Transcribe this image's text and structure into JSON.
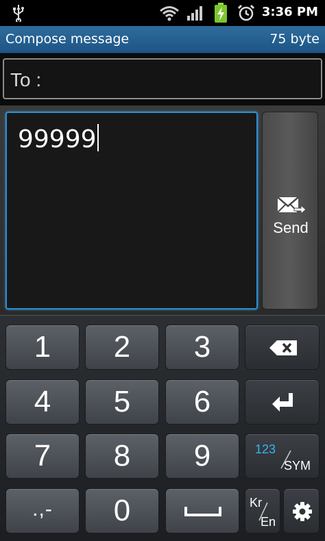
{
  "status_bar": {
    "time": "3:36 PM",
    "icons": [
      "usb-icon",
      "wifi-icon",
      "signal-icon",
      "battery-charging-icon",
      "alarm-icon"
    ]
  },
  "title_bar": {
    "title": "Compose message",
    "byte_count": "75 byte"
  },
  "recipient": {
    "label": "To :",
    "value": ""
  },
  "message": {
    "text": "99999"
  },
  "send_button": {
    "label": "Send",
    "icon": "send-mail-icon"
  },
  "keyboard": {
    "digits": [
      "1",
      "2",
      "3",
      "4",
      "5",
      "6",
      "7",
      "8",
      "9",
      "0"
    ],
    "punctuation": ".,-",
    "sym_key": {
      "top": "123",
      "bottom": "SYM"
    },
    "lang_key": {
      "top": "Kr",
      "bottom": "En"
    },
    "icons": [
      "backspace-icon",
      "enter-icon",
      "space-icon",
      "settings-gear-icon"
    ]
  },
  "colors": {
    "title_bar": "#2a6597",
    "focus_border": "#2f8fd2",
    "sym_accent": "#35b4ee"
  }
}
